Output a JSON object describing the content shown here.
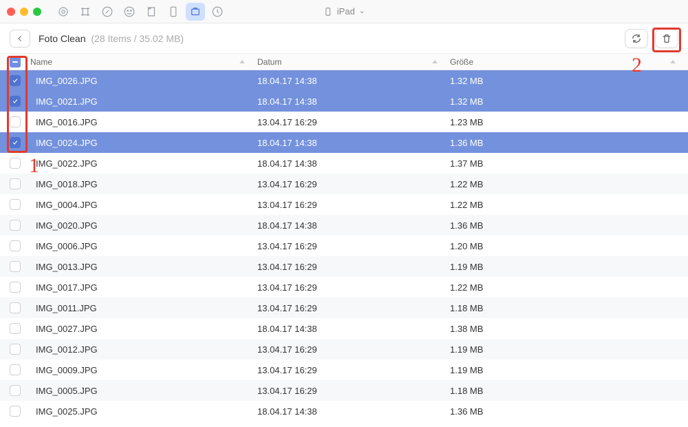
{
  "device": {
    "label": "iPad"
  },
  "breadcrumb": {
    "title": "Foto Clean",
    "meta": "(28 Items / 35.02 MB)"
  },
  "columns": {
    "name": "Name",
    "date": "Datum",
    "size": "Größe"
  },
  "annotations": {
    "one": "1",
    "two": "2"
  },
  "rows": [
    {
      "name": "IMG_0026.JPG",
      "date": "18.04.17 14:38",
      "size": "1.32 MB",
      "checked": true,
      "selected": true,
      "alt": false
    },
    {
      "name": "IMG_0021.JPG",
      "date": "18.04.17 14:38",
      "size": "1.32 MB",
      "checked": true,
      "selected": true,
      "alt": true
    },
    {
      "name": "IMG_0016.JPG",
      "date": "13.04.17 16:29",
      "size": "1.23 MB",
      "checked": false,
      "selected": false,
      "alt": false
    },
    {
      "name": "IMG_0024.JPG",
      "date": "18.04.17 14:38",
      "size": "1.36 MB",
      "checked": true,
      "selected": true,
      "alt": true
    },
    {
      "name": "IMG_0022.JPG",
      "date": "18.04.17 14:38",
      "size": "1.37 MB",
      "checked": false,
      "selected": false,
      "alt": false
    },
    {
      "name": "IMG_0018.JPG",
      "date": "13.04.17 16:29",
      "size": "1.22 MB",
      "checked": false,
      "selected": false,
      "alt": true
    },
    {
      "name": "IMG_0004.JPG",
      "date": "13.04.17 16:29",
      "size": "1.22 MB",
      "checked": false,
      "selected": false,
      "alt": false
    },
    {
      "name": "IMG_0020.JPG",
      "date": "18.04.17 14:38",
      "size": "1.36 MB",
      "checked": false,
      "selected": false,
      "alt": true
    },
    {
      "name": "IMG_0006.JPG",
      "date": "13.04.17 16:29",
      "size": "1.20 MB",
      "checked": false,
      "selected": false,
      "alt": false
    },
    {
      "name": "IMG_0013.JPG",
      "date": "13.04.17 16:29",
      "size": "1.19 MB",
      "checked": false,
      "selected": false,
      "alt": true
    },
    {
      "name": "IMG_0017.JPG",
      "date": "13.04.17 16:29",
      "size": "1.22 MB",
      "checked": false,
      "selected": false,
      "alt": false
    },
    {
      "name": "IMG_0011.JPG",
      "date": "13.04.17 16:29",
      "size": "1.18 MB",
      "checked": false,
      "selected": false,
      "alt": true
    },
    {
      "name": "IMG_0027.JPG",
      "date": "18.04.17 14:38",
      "size": "1.38 MB",
      "checked": false,
      "selected": false,
      "alt": false
    },
    {
      "name": "IMG_0012.JPG",
      "date": "13.04.17 16:29",
      "size": "1.19 MB",
      "checked": false,
      "selected": false,
      "alt": true
    },
    {
      "name": "IMG_0009.JPG",
      "date": "13.04.17 16:29",
      "size": "1.19 MB",
      "checked": false,
      "selected": false,
      "alt": false
    },
    {
      "name": "IMG_0005.JPG",
      "date": "13.04.17 16:29",
      "size": "1.18 MB",
      "checked": false,
      "selected": false,
      "alt": true
    },
    {
      "name": "IMG_0025.JPG",
      "date": "18.04.17 14:38",
      "size": "1.36 MB",
      "checked": false,
      "selected": false,
      "alt": false
    }
  ]
}
